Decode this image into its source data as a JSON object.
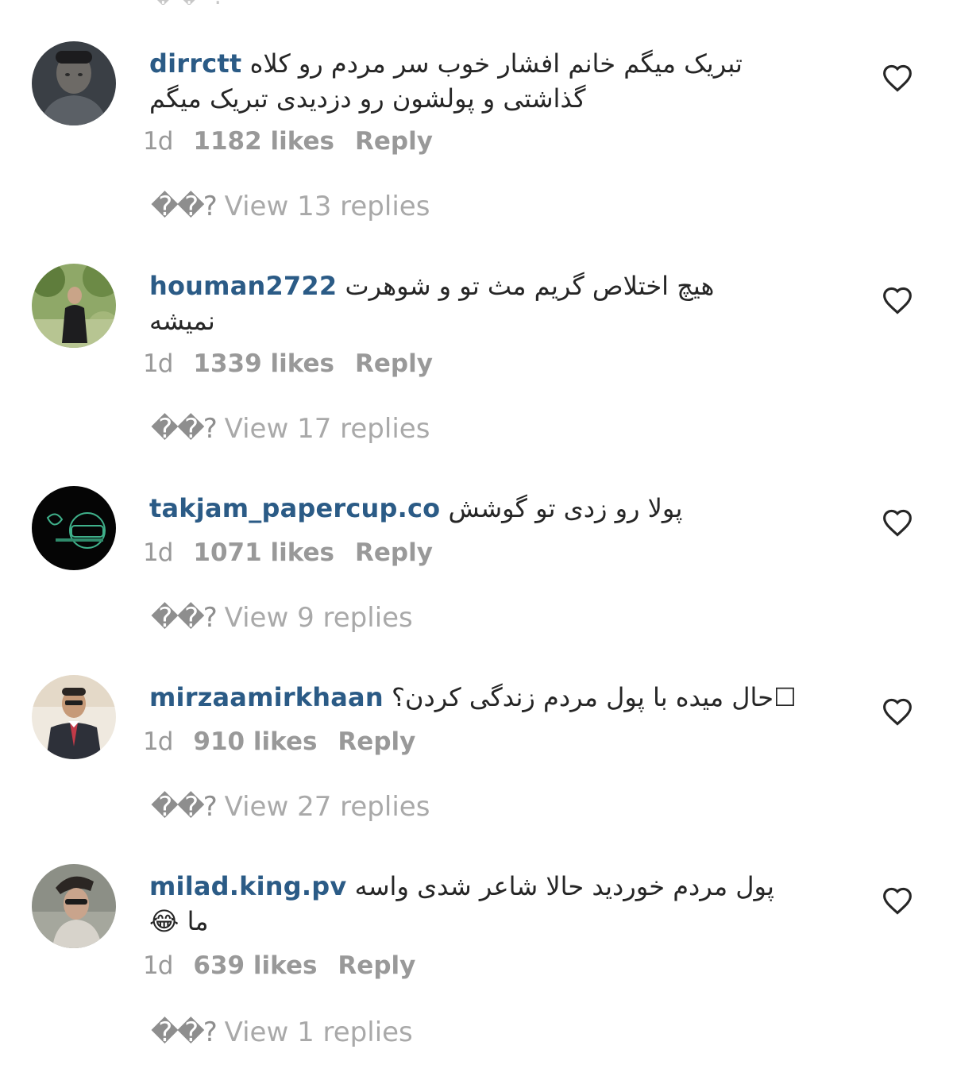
{
  "feed": {
    "top_stub": "�� ?",
    "comments": [
      {
        "username": "dirrctt",
        "text_line1": "تبریک میگم خانم افشار خوب سر مردم رو کلاه",
        "text_line2": "گذاشتی و پولشون رو دزدیدی تبریک میگم",
        "age": "1d",
        "likes": "1182 likes",
        "reply": "Reply",
        "view_glyph": "��?",
        "view_replies": " View 13 replies"
      },
      {
        "username": "houman2722",
        "text_line1": "هیچ اختلاص گریم مث تو و شوهرت",
        "text_line2": "نمیشه",
        "age": "1d",
        "likes": "1339 likes",
        "reply": "Reply",
        "view_glyph": "��?",
        "view_replies": " View 17 replies"
      },
      {
        "username": "takjam_papercup.co",
        "text_line1": "پولا رو زدی تو گوشش",
        "text_line2": "",
        "age": "1d",
        "likes": "1071 likes",
        "reply": "Reply",
        "view_glyph": "��?",
        "view_replies": " View 9 replies"
      },
      {
        "username": "mirzaamirkhaan",
        "text_line1": "حال میده با پول مردم زندگی کردن؟☐",
        "text_line2": "",
        "age": "1d",
        "likes": "910 likes",
        "reply": "Reply",
        "view_glyph": "��?",
        "view_replies": " View 27 replies"
      },
      {
        "username": "milad.king.pv",
        "text_line1": "پول مردم خوردید حالا شاعر شدی واسه",
        "text_line2": "ما 😂",
        "age": "1d",
        "likes": "639 likes",
        "reply": "Reply",
        "view_glyph": "��?",
        "view_replies": " View 1 replies"
      }
    ]
  },
  "icons": {
    "like": "heart-outline-icon"
  },
  "colors": {
    "username": "#2b5b86",
    "meta": "#999999",
    "view_replies": "#a9a9a9"
  }
}
